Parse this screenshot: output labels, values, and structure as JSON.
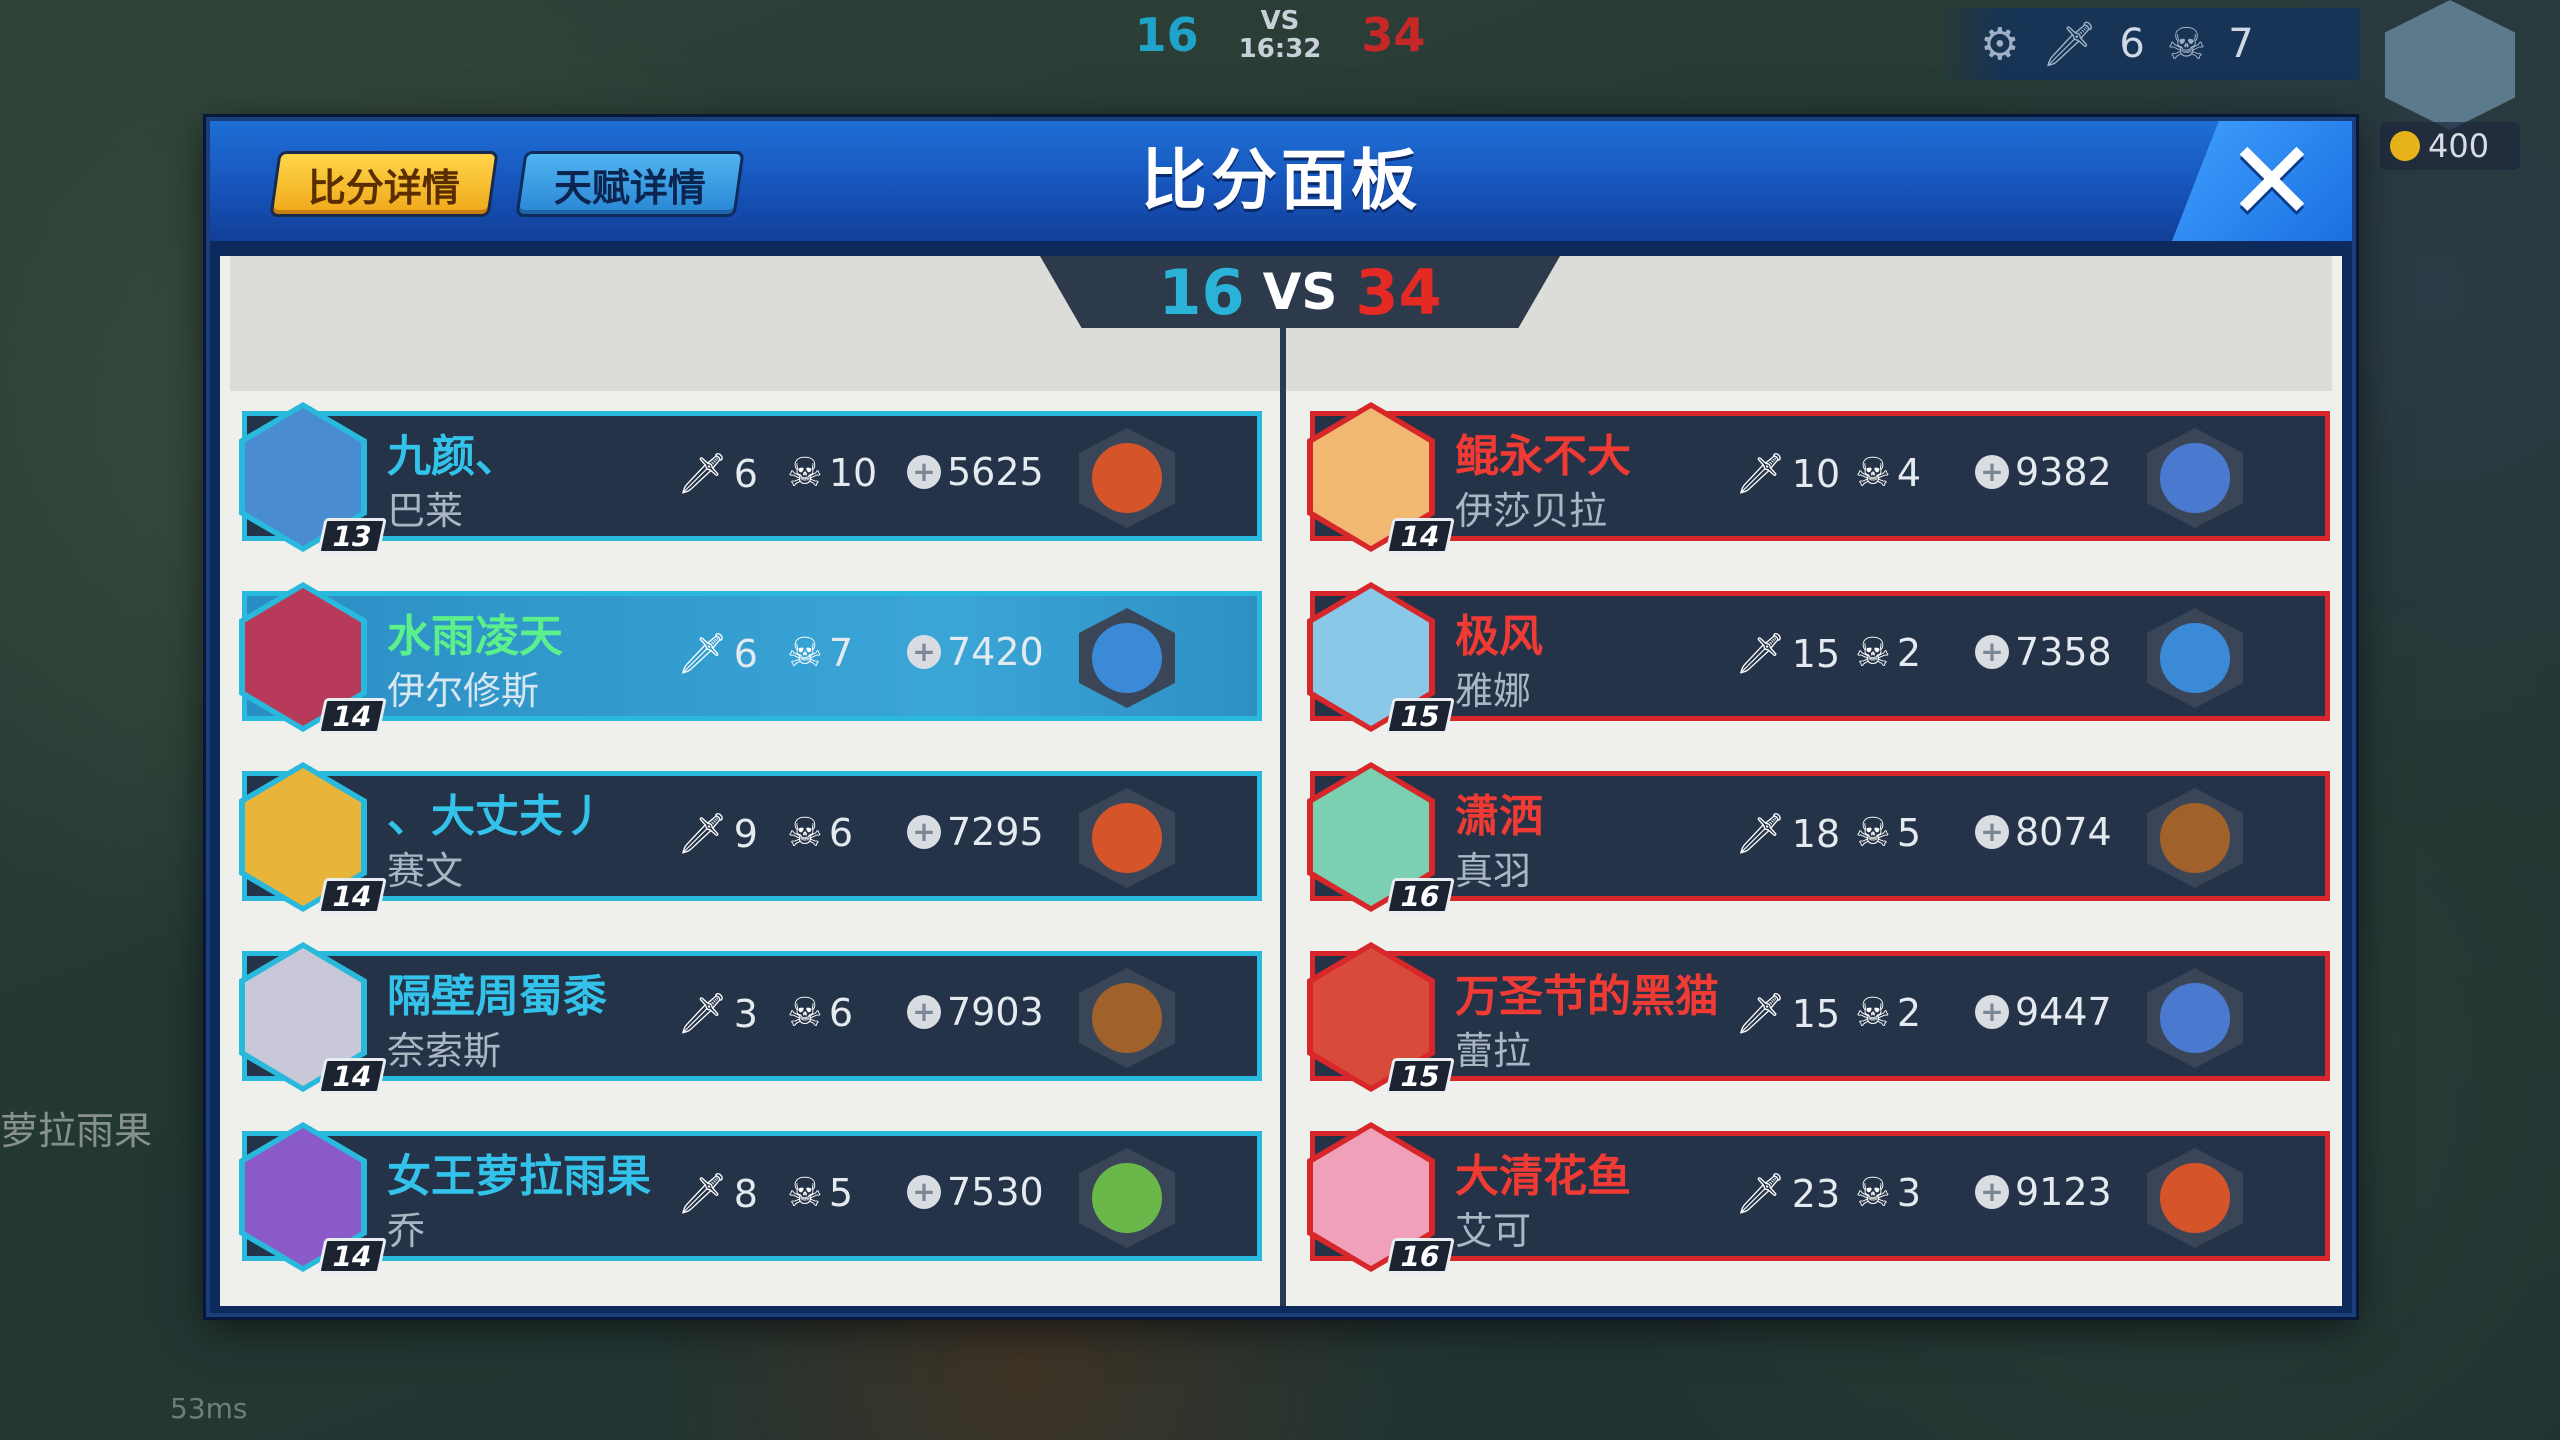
{
  "hud": {
    "blue_score": "16",
    "vs": "VS",
    "time": "16:32",
    "red_score": "34",
    "kills": "6",
    "deaths": "7",
    "coins": "400",
    "player_name": "萝拉雨果",
    "ping": "53ms"
  },
  "panel": {
    "title": "比分面板",
    "tab_score": "比分详情",
    "tab_talent": "天赋详情",
    "close_glyph": "✕"
  },
  "score": {
    "blue": "16",
    "vs": "VS",
    "red": "34"
  },
  "blue_team": [
    {
      "player": "九颜、",
      "hero": "巴莱",
      "level": "13",
      "kills": "6",
      "deaths": "10",
      "gold": "5625",
      "portrait_color": "#4a8cd0",
      "item_color": "#d6542a"
    },
    {
      "player": "水雨凌天",
      "hero": "伊尔修斯",
      "level": "14",
      "kills": "6",
      "deaths": "7",
      "gold": "7420",
      "portrait_color": "#b83a5a",
      "item_color": "#3a8ad8"
    },
    {
      "player": "、大丈夫丿",
      "hero": "赛文",
      "level": "14",
      "kills": "9",
      "deaths": "6",
      "gold": "7295",
      "portrait_color": "#e8b43a",
      "item_color": "#d6542a"
    },
    {
      "player": "隔壁周蜀黍",
      "hero": "奈索斯",
      "level": "14",
      "kills": "3",
      "deaths": "6",
      "gold": "7903",
      "portrait_color": "#c8c8d8",
      "item_color": "#a0622a"
    },
    {
      "player": "女王萝拉雨果",
      "hero": "乔",
      "level": "14",
      "kills": "8",
      "deaths": "5",
      "gold": "7530",
      "portrait_color": "#8a5ac8",
      "item_color": "#6ab84a"
    }
  ],
  "red_team": [
    {
      "player": "鲲永不大",
      "hero": "伊莎贝拉",
      "level": "14",
      "kills": "10",
      "deaths": "4",
      "gold": "9382",
      "portrait_color": "#f0b870",
      "item_color": "#4a7ad0"
    },
    {
      "player": "极风",
      "hero": "雅娜",
      "level": "15",
      "kills": "15",
      "deaths": "2",
      "gold": "7358",
      "portrait_color": "#8ac8e8",
      "item_color": "#3a8ad8"
    },
    {
      "player": "潇洒",
      "hero": "真羽",
      "level": "16",
      "kills": "18",
      "deaths": "5",
      "gold": "8074",
      "portrait_color": "#7ad0b0",
      "item_color": "#a0622a"
    },
    {
      "player": "万圣节的黑猫",
      "hero": "蕾拉",
      "level": "15",
      "kills": "15",
      "deaths": "2",
      "gold": "9447",
      "portrait_color": "#d84a3a",
      "item_color": "#4a7ad0"
    },
    {
      "player": "大清花鱼",
      "hero": "艾可",
      "level": "16",
      "kills": "23",
      "deaths": "3",
      "gold": "9123",
      "portrait_color": "#f0a0b8",
      "item_color": "#d6542a"
    }
  ],
  "icons": {
    "kill": "sword-icon",
    "death": "skull-icon",
    "gold": "coin-icon",
    "settings": "gear-icon",
    "chat": "chat-icon"
  },
  "colors": {
    "blue_team": "#29b9dc",
    "red_team": "#d8272a",
    "highlight_row": "#3aa6d6"
  }
}
